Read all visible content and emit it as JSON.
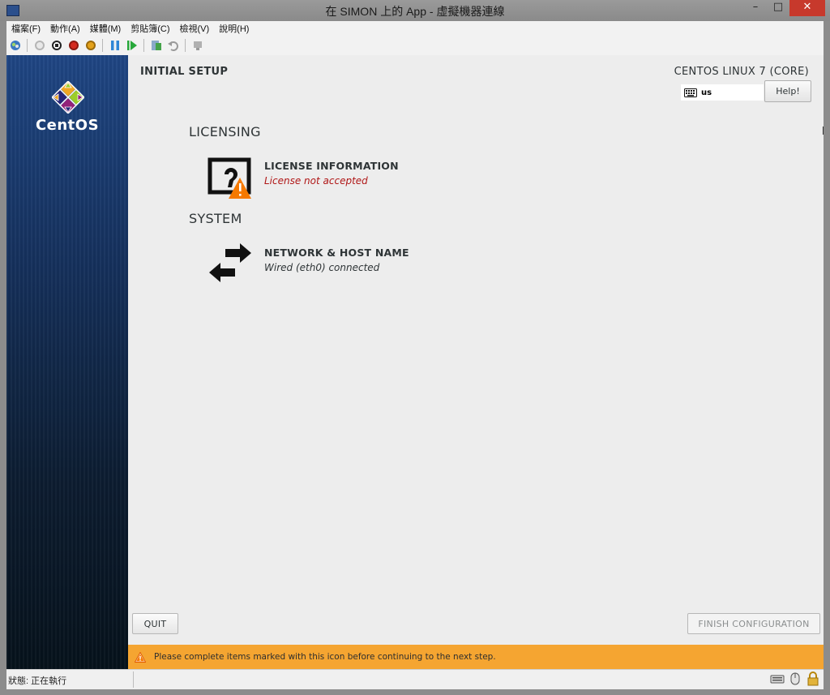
{
  "window": {
    "title": "在 SIMON 上的 App - 虛擬機器連線",
    "controls": {
      "minimize": "–",
      "maximize": "□",
      "close": "✕"
    }
  },
  "menu": [
    "檔案(F)",
    "動作(A)",
    "媒體(M)",
    "剪貼簿(C)",
    "檢視(V)",
    "說明(H)"
  ],
  "toolbar": {
    "icons": [
      "ctrl-alt-del-icon",
      "start-icon",
      "turn-off-icon",
      "shutdown-icon",
      "power-icon",
      "pause-icon",
      "resume-icon",
      "checkpoint-icon",
      "revert-icon",
      "enhanced-session-icon"
    ]
  },
  "sidebar": {
    "logo_text": "CentOS"
  },
  "header": {
    "title": "INITIAL SETUP",
    "product": "CENTOS LINUX 7 (CORE)",
    "keyboard_layout": "us",
    "help_label": "Help!"
  },
  "sections": [
    {
      "title": "LICENSING",
      "spokes": [
        {
          "title": "LICENSE INFORMATION",
          "status": "License not accepted",
          "warning": true
        }
      ]
    },
    {
      "title": "SYSTEM",
      "spokes": [
        {
          "title": "NETWORK & HOST NAME",
          "status": "Wired (eth0) connected",
          "warning": false
        }
      ]
    }
  ],
  "footer": {
    "quit_label": "QUIT",
    "finish_label": "FINISH CONFIGURATION",
    "warning_text": "Please complete items marked with this icon before continuing to the next step."
  },
  "statusbar": {
    "text": "狀態: 正在執行"
  },
  "colors": {
    "warning_bar": "#f5a531",
    "warning_status_text": "#b01717",
    "sidebar_top": "#1f4684",
    "sidebar_bottom": "#06121b"
  }
}
